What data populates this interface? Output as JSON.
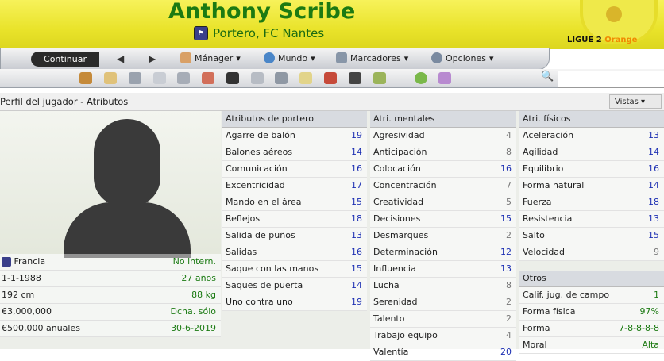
{
  "header": {
    "player_name": "Anthony Scribe",
    "subtitle": "Portero, FC Nantes",
    "league_name": "LIGUE 2",
    "league_sponsor": "Orange"
  },
  "toolbar": {
    "continue_label": "Continuar",
    "manager_label": "Mánager",
    "world_label": "Mundo",
    "bookmarks_label": "Marcadores",
    "options_label": "Opciones"
  },
  "iconbar": {
    "icons": [
      "home-icon",
      "bread-icon",
      "notes-icon",
      "calendar-icon",
      "squad-icon",
      "transfer-icon",
      "film-icon",
      "trophy-icon",
      "tactics-icon",
      "clipboard-icon",
      "match-icon",
      "binoculars-icon",
      "finance-icon",
      "help-icon",
      "question-icon"
    ]
  },
  "page": {
    "title": "Perfil del jugador - Atributos",
    "views_label": "Vistas"
  },
  "info": {
    "nationality": "Francia",
    "international": "No intern.",
    "birth_date": "1-1-1988",
    "age": "27 años",
    "height": "192 cm",
    "weight": "88 kg",
    "value": "€3,000,000",
    "foot": "Dcha. sólo",
    "wage": "€500,000 anuales",
    "contract_end": "30-6-2019"
  },
  "goalkeeping": {
    "header": "Atributos de portero",
    "rows": [
      {
        "label": "Agarre de balón",
        "value": "19",
        "color": "blue"
      },
      {
        "label": "Balones aéreos",
        "value": "14",
        "color": "blue"
      },
      {
        "label": "Comunicación",
        "value": "16",
        "color": "blue"
      },
      {
        "label": "Excentricidad",
        "value": "17",
        "color": "blue"
      },
      {
        "label": "Mando en el área",
        "value": "15",
        "color": "blue"
      },
      {
        "label": "Reflejos",
        "value": "18",
        "color": "blue"
      },
      {
        "label": "Salida de puños",
        "value": "13",
        "color": "blue"
      },
      {
        "label": "Salidas",
        "value": "16",
        "color": "blue"
      },
      {
        "label": "Saque con las manos",
        "value": "15",
        "color": "blue"
      },
      {
        "label": "Saques de puerta",
        "value": "14",
        "color": "blue"
      },
      {
        "label": "Uno contra uno",
        "value": "19",
        "color": "blue"
      }
    ]
  },
  "mental": {
    "header": "Atri. mentales",
    "rows": [
      {
        "label": "Agresividad",
        "value": "4",
        "color": "gray"
      },
      {
        "label": "Anticipación",
        "value": "8",
        "color": "gray"
      },
      {
        "label": "Colocación",
        "value": "16",
        "color": "blue"
      },
      {
        "label": "Concentración",
        "value": "7",
        "color": "gray"
      },
      {
        "label": "Creatividad",
        "value": "5",
        "color": "gray"
      },
      {
        "label": "Decisiones",
        "value": "15",
        "color": "blue"
      },
      {
        "label": "Desmarques",
        "value": "2",
        "color": "gray"
      },
      {
        "label": "Determinación",
        "value": "12",
        "color": "blue"
      },
      {
        "label": "Influencia",
        "value": "13",
        "color": "blue"
      },
      {
        "label": "Lucha",
        "value": "8",
        "color": "gray"
      },
      {
        "label": "Serenidad",
        "value": "2",
        "color": "gray"
      },
      {
        "label": "Talento",
        "value": "2",
        "color": "gray"
      },
      {
        "label": "Trabajo equipo",
        "value": "4",
        "color": "gray"
      },
      {
        "label": "Valentía",
        "value": "20",
        "color": "blue"
      }
    ]
  },
  "physical": {
    "header": "Atri. físicos",
    "rows": [
      {
        "label": "Aceleración",
        "value": "13",
        "color": "blue"
      },
      {
        "label": "Agilidad",
        "value": "14",
        "color": "blue"
      },
      {
        "label": "Equilibrio",
        "value": "16",
        "color": "blue"
      },
      {
        "label": "Forma natural",
        "value": "14",
        "color": "blue"
      },
      {
        "label": "Fuerza",
        "value": "18",
        "color": "blue"
      },
      {
        "label": "Resistencia",
        "value": "13",
        "color": "blue"
      },
      {
        "label": "Salto",
        "value": "15",
        "color": "blue"
      },
      {
        "label": "Velocidad",
        "value": "9",
        "color": "gray"
      }
    ]
  },
  "other": {
    "header": "Otros",
    "rows": [
      {
        "label": "Calif. jug. de campo",
        "value": "1",
        "color": "green"
      },
      {
        "label": "Forma física",
        "value": "97%",
        "color": "green"
      },
      {
        "label": "Forma",
        "value": "7-8-8-8-8",
        "color": "green"
      },
      {
        "label": "Moral",
        "value": "Alta",
        "color": "green"
      }
    ]
  }
}
